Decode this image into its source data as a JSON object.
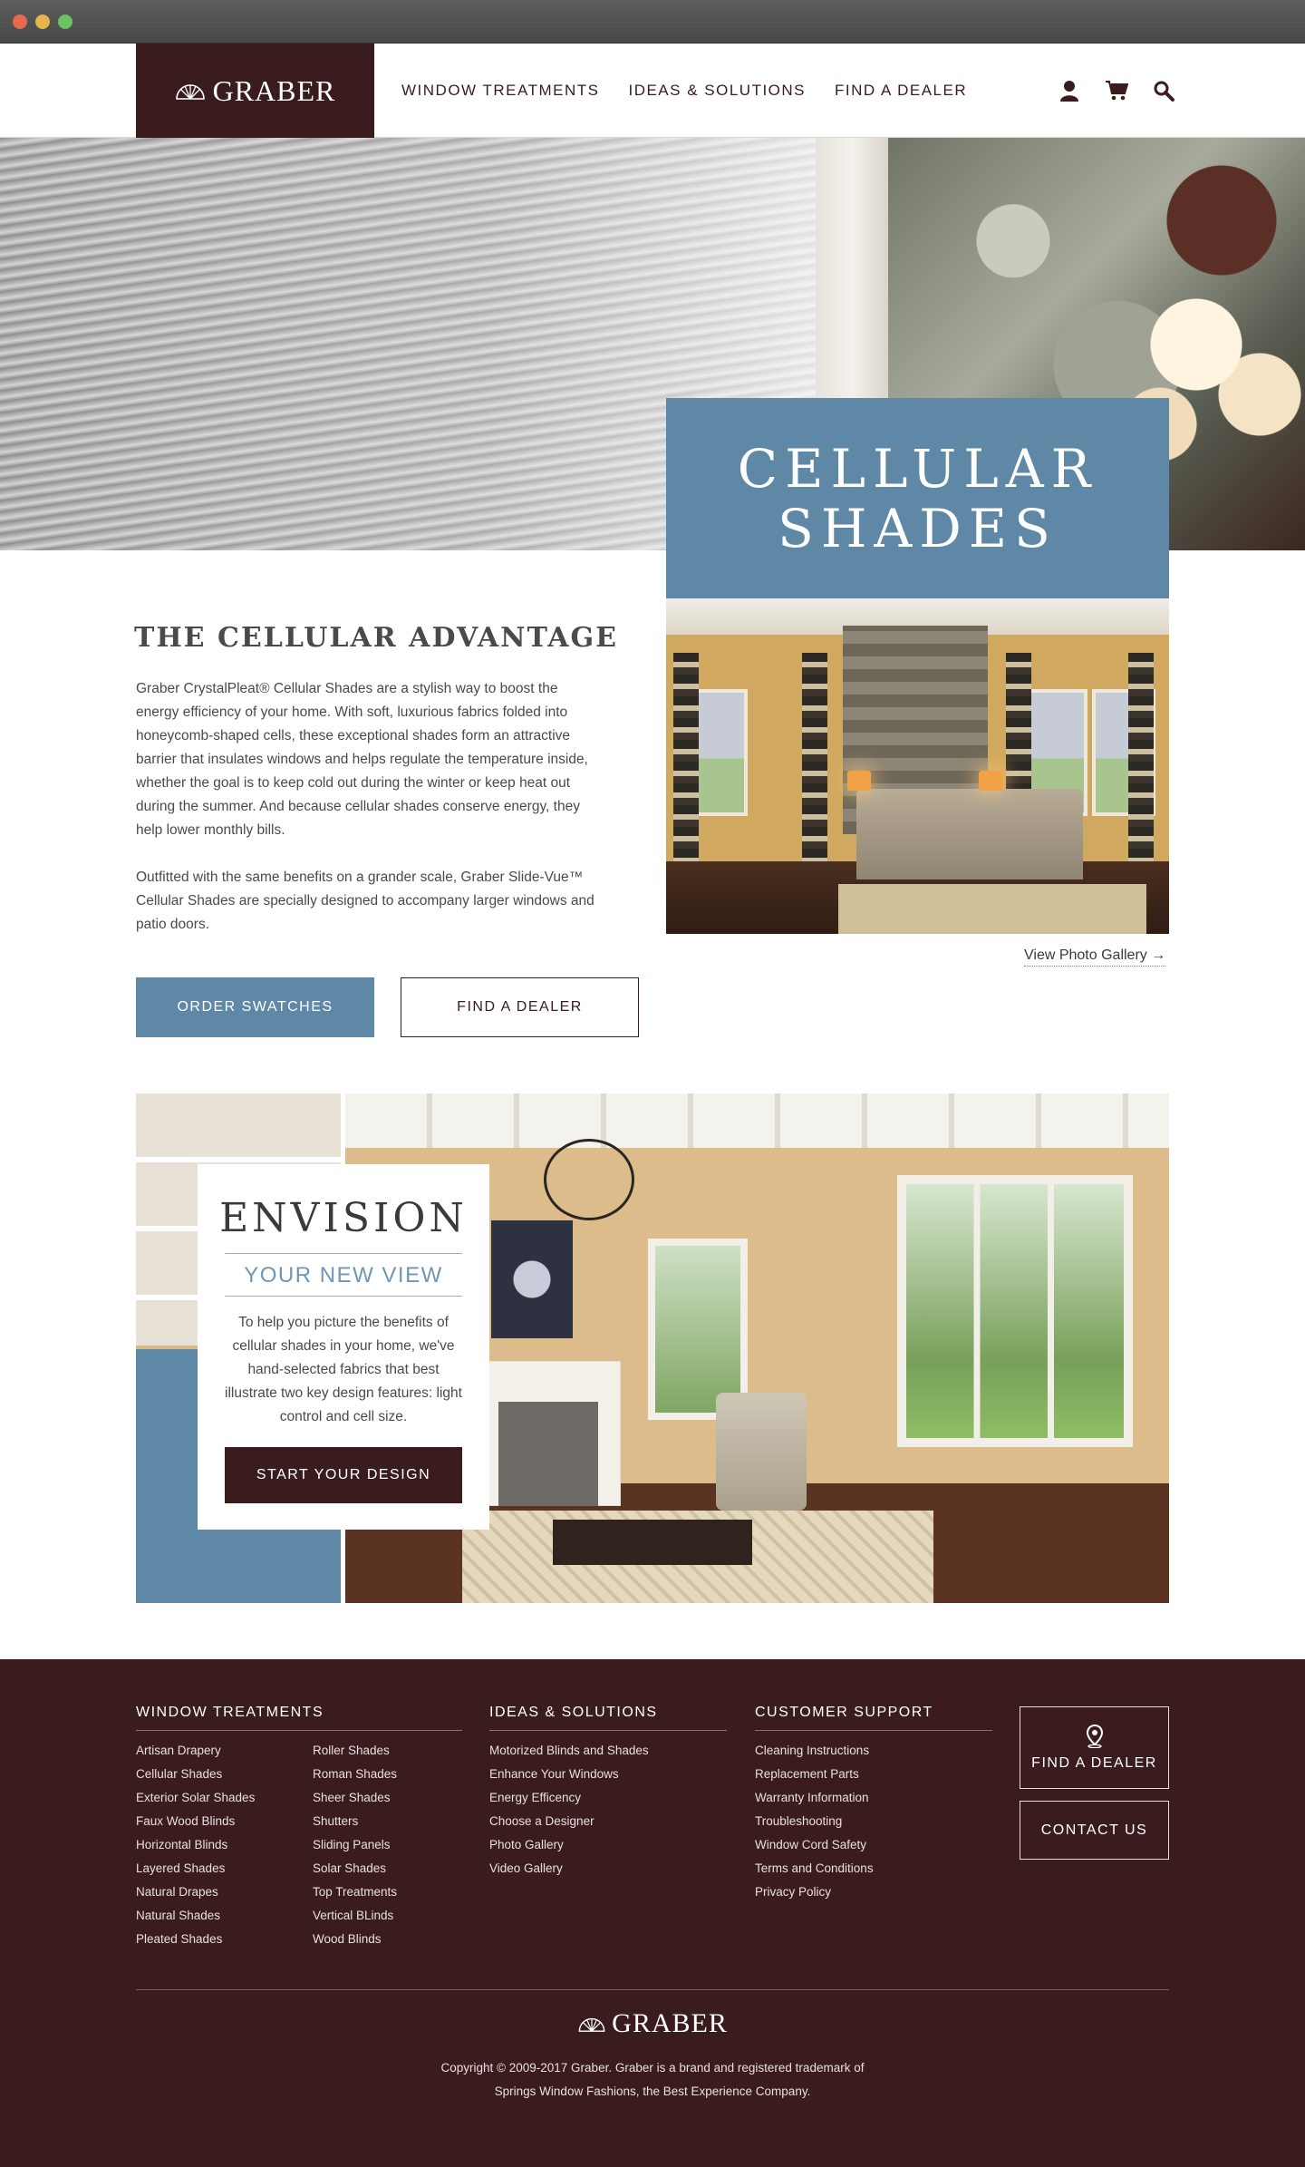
{
  "header": {
    "logo": "GRABER",
    "nav": [
      "WINDOW TREATMENTS",
      "IDEAS & SOLUTIONS",
      "FIND A DEALER"
    ],
    "icons": [
      "user-icon",
      "cart-icon",
      "search-icon"
    ]
  },
  "hero": {
    "title_line1": "CELLULAR",
    "title_line2": "SHADES",
    "gallery_link": "View Photo Gallery →"
  },
  "advantage": {
    "title": "THE CELLULAR ADVANTAGE",
    "p1": "Graber CrystalPleat® Cellular Shades are a stylish way to boost the energy efficiency of your home. With soft, luxurious fabrics folded into honeycomb-shaped cells, these exceptional shades form an attractive barrier that insulates windows and helps regulate the temperature inside, whether the goal is to keep cold out during the winter or keep heat out during the summer. And because cellular shades conserve energy, they help lower monthly bills.",
    "p2": "Outfitted with the same benefits on a grander scale, Graber Slide-Vue™ Cellular Shades are specially designed to accompany larger windows and patio doors.",
    "order_swatches": "ORDER SWATCHES",
    "find_dealer": "FIND A DEALER"
  },
  "envision": {
    "title": "ENVISION",
    "subtitle": "YOUR NEW VIEW",
    "text": "To help you picture the benefits of cellular shades in your home, we've hand-selected fabrics that best illustrate two key design features: light control and cell size.",
    "button": "START YOUR DESIGN"
  },
  "footer": {
    "window_treatments": {
      "title": "WINDOW TREATMENTS",
      "col1": [
        "Artisan Drapery",
        "Cellular Shades",
        "Exterior Solar Shades",
        "Faux Wood Blinds",
        "Horizontal Blinds",
        "Layered Shades",
        "Natural Drapes",
        "Natural Shades",
        "Pleated Shades"
      ],
      "col2": [
        "Roller Shades",
        "Roman Shades",
        "Sheer Shades",
        "Shutters",
        "Sliding Panels",
        "Solar Shades",
        "Top Treatments",
        "Vertical BLinds",
        "Wood Blinds"
      ]
    },
    "ideas": {
      "title": "IDEAS & SOLUTIONS",
      "items": [
        "Motorized Blinds and Shades",
        "Enhance Your Windows",
        "Energy Efficency",
        "Choose a Designer",
        "Photo Gallery",
        "Video Gallery"
      ]
    },
    "support": {
      "title": "CUSTOMER SUPPORT",
      "items": [
        "Cleaning Instructions",
        "Replacement Parts",
        "Warranty Information",
        "Troubleshooting",
        "Window Cord Safety",
        "Terms and Conditions",
        "Privacy Policy"
      ]
    },
    "find_dealer": "FIND A DEALER",
    "contact_us": "CONTACT US",
    "logo": "GRABER",
    "copyright_line1": "Copyright © 2009-2017 Graber. Graber is a brand and registered trademark of",
    "copyright_line2": "Springs Window Fashions, the Best Experience Company."
  },
  "colors": {
    "brand_dark": "#3a1c1f",
    "accent_blue": "#5e88a6"
  }
}
